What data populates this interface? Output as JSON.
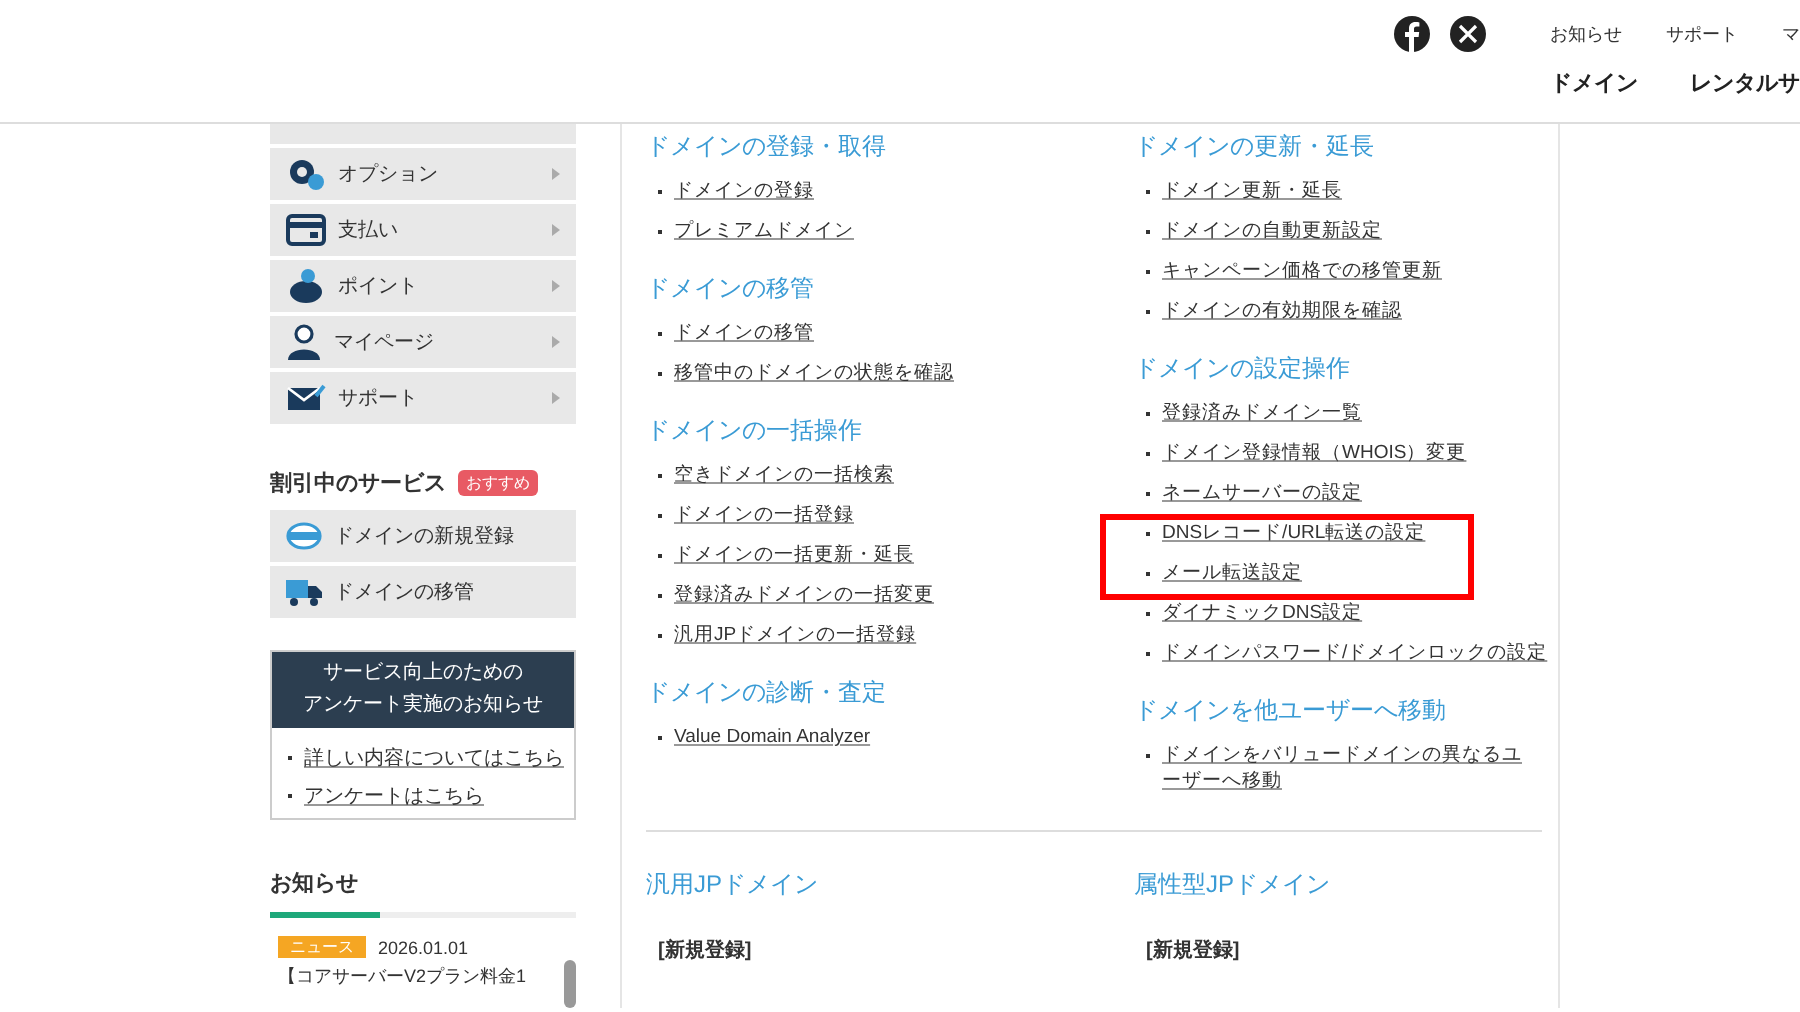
{
  "header": {
    "top_links": [
      "お知らせ",
      "サポート",
      "マ"
    ],
    "nav": [
      "ドメイン",
      "レンタルサ"
    ]
  },
  "sidebar": {
    "menu": [
      {
        "label": "オプション"
      },
      {
        "label": "支払い"
      },
      {
        "label": "ポイント"
      },
      {
        "label": "マイページ"
      },
      {
        "label": "サポート"
      }
    ],
    "discount": {
      "title": "割引中のサービス",
      "badge": "おすすめ",
      "items": [
        {
          "label": "ドメインの新規登録"
        },
        {
          "label": "ドメインの移管"
        }
      ]
    },
    "survey": {
      "title_lines": [
        "サービス向上のための",
        "アンケート実施のお知らせ"
      ],
      "links": [
        "詳しい内容についてはこちら",
        "アンケートはこちら"
      ]
    },
    "news": {
      "title": "お知らせ",
      "items": [
        {
          "tag": "ニュース",
          "date": "2026.01.01",
          "text": "【コアサーバーV2プラン料金1"
        }
      ]
    }
  },
  "main": {
    "columns": [
      [
        {
          "title": "ドメインの登録・取得",
          "links": [
            "ドメインの登録",
            "プレミアムドメイン"
          ]
        },
        {
          "title": "ドメインの移管",
          "links": [
            "ドメインの移管",
            "移管中のドメインの状態を確認"
          ]
        },
        {
          "title": "ドメインの一括操作",
          "links": [
            "空きドメインの一括検索",
            "ドメインの一括登録",
            "ドメインの一括更新・延長",
            "登録済みドメインの一括変更",
            "汎用JPドメインの一括登録"
          ]
        },
        {
          "title": "ドメインの診断・査定",
          "links": [
            "Value Domain Analyzer"
          ]
        }
      ],
      [
        {
          "title": "ドメインの更新・延長",
          "links": [
            "ドメイン更新・延長",
            "ドメインの自動更新設定",
            "キャンペーン価格での移管更新",
            "ドメインの有効期限を確認"
          ]
        },
        {
          "title": "ドメインの設定操作",
          "links": [
            "登録済みドメイン一覧",
            "ドメイン登録情報（WHOIS）変更",
            "ネームサーバーの設定",
            "DNSレコード/URL転送の設定",
            "メール転送設定",
            "ダイナミックDNS設定",
            "ドメインパスワード/ドメインロックの設定"
          ]
        },
        {
          "title": "ドメインを他ユーザーへ移動",
          "links": [
            "ドメインをバリュードメインの異なるユーザーへ移動"
          ]
        }
      ]
    ],
    "bottom": [
      {
        "title": "汎用JPドメイン",
        "sub": "[新規登録]"
      },
      {
        "title": "属性型JPドメイン",
        "sub": "[新規登録]"
      }
    ]
  }
}
